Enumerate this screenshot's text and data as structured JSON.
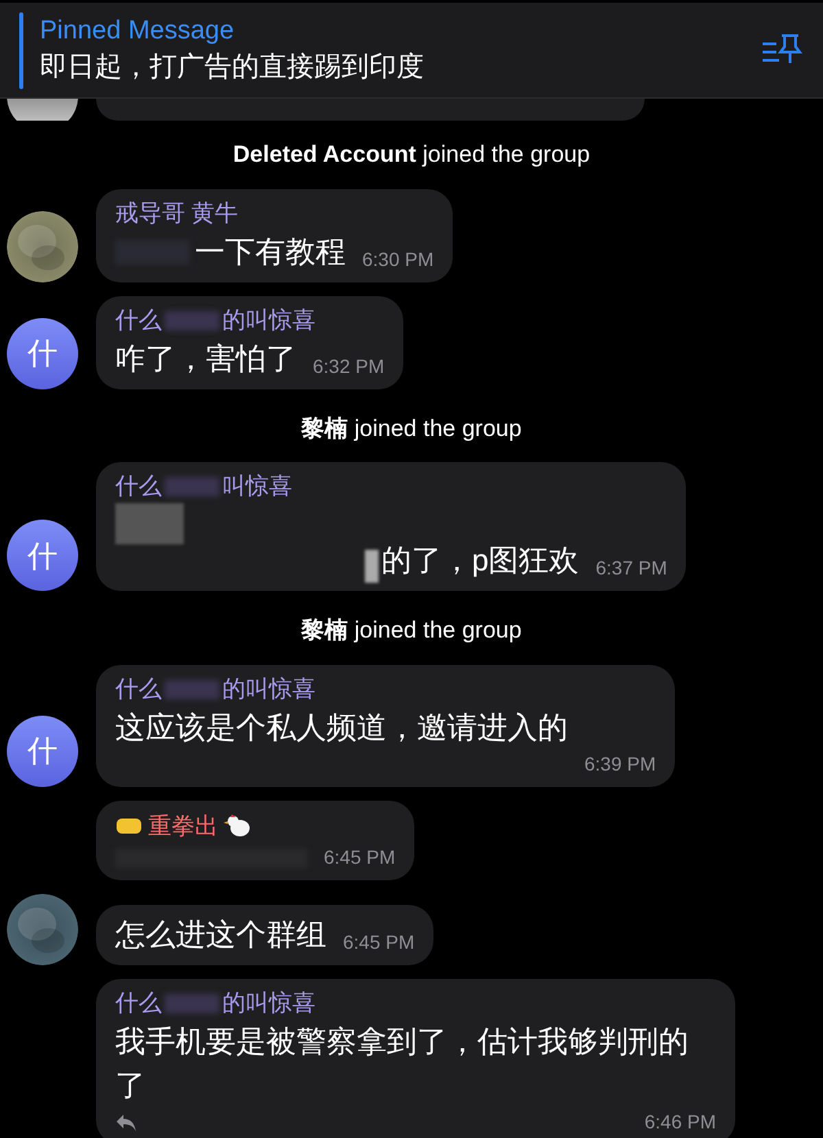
{
  "pinned": {
    "title": "Pinned Message",
    "text": "即日起，打广告的直接踢到印度"
  },
  "items": [
    {
      "kind": "partial"
    },
    {
      "kind": "service",
      "name": "Deleted Account",
      "text": "joined the group"
    },
    {
      "kind": "message",
      "avatar": {
        "kind": "picture",
        "color": "#8a8a6a"
      },
      "sender": [
        "戒导哥 黄牛"
      ],
      "redaction": {
        "kind": "before"
      },
      "text": "一下有教程",
      "time": "6:30 PM"
    },
    {
      "kind": "message",
      "avatar": {
        "kind": "letter",
        "letter": "什"
      },
      "sender": [
        "什么",
        "的叫惊喜"
      ],
      "text": "咋了，害怕了",
      "time": "6:32 PM"
    },
    {
      "kind": "service",
      "name": "黎楠",
      "text": "joined the group"
    },
    {
      "kind": "message",
      "avatar": {
        "kind": "letter",
        "letter": "什"
      },
      "sender": [
        "什么",
        "叫惊喜"
      ],
      "redaction": {
        "kind": "block"
      },
      "text": "的了，p图狂欢",
      "time": "6:37 PM"
    },
    {
      "kind": "service",
      "name": "黎楠",
      "text": "joined the group"
    },
    {
      "kind": "message",
      "avatar": {
        "kind": "letter",
        "letter": "什"
      },
      "sender": [
        "什么",
        "的叫惊喜"
      ],
      "text": "这应该是个私人频道，邀请进入的",
      "time": "6:39 PM",
      "time_below": true
    },
    {
      "kind": "message",
      "sender_red": "重拳出",
      "redaction": {
        "kind": "line"
      },
      "time": "6:45 PM"
    },
    {
      "kind": "message",
      "avatar": {
        "kind": "picture",
        "color": "#4a6470"
      },
      "text": "怎么进这个群组",
      "time": "6:45 PM"
    },
    {
      "kind": "message",
      "sender": [
        "什么",
        "的叫惊喜"
      ],
      "text": "我手机要是被警察拿到了，估计我够判刑的了",
      "time": "6:46 PM",
      "reply_icon": true
    }
  ]
}
